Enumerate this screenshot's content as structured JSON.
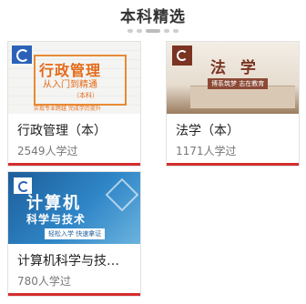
{
  "section": {
    "title": "本科精选"
  },
  "courses": [
    {
      "name": "行政管理（本）",
      "learners": "2549人学过",
      "thumb": {
        "title": "行政管理",
        "subtitle": "从入门到精通",
        "edition": "（本科）",
        "tagline": "实现专业跨越 完成学历提升"
      }
    },
    {
      "name": "法学（本）",
      "learners": "1171人学过",
      "thumb": {
        "title": "法 学",
        "tagline": "博系筑梦 志在教育"
      }
    },
    {
      "name": "计算机科学与技…",
      "learners": "780人学过",
      "thumb": {
        "title": "计算机",
        "subtitle": "科学与技术",
        "tagline": "轻松入学 快速拿证"
      }
    }
  ],
  "colors": {
    "accent": "#d42e2e"
  }
}
